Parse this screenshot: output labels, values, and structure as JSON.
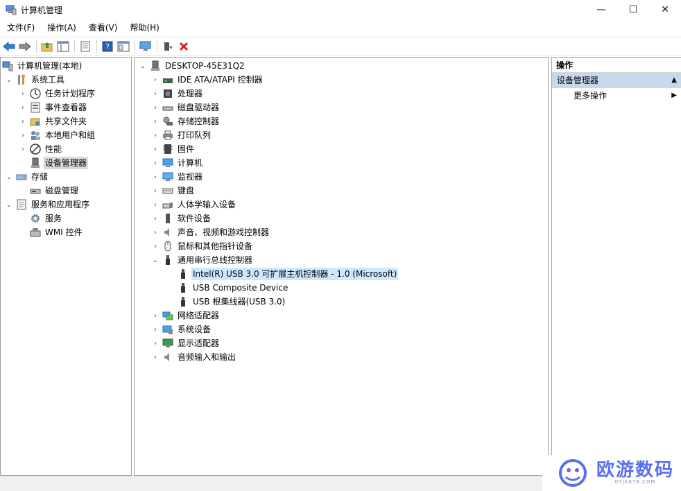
{
  "window": {
    "title": "计算机管理",
    "controls": {
      "minimize": "—",
      "maximize": "☐",
      "close": "✕"
    }
  },
  "menu": [
    "文件(F)",
    "操作(A)",
    "查看(V)",
    "帮助(H)"
  ],
  "left_tree": {
    "root": "计算机管理(本地)",
    "system_tools": "系统工具",
    "task_scheduler": "任务计划程序",
    "event_viewer": "事件查看器",
    "shared_folders": "共享文件夹",
    "local_users": "本地用户和组",
    "performance": "性能",
    "device_manager": "设备管理器",
    "storage": "存储",
    "disk_management": "磁盘管理",
    "services_apps": "服务和应用程序",
    "services": "服务",
    "wmi": "WMI 控件"
  },
  "device_tree": {
    "computer": "DESKTOP-45E31Q2",
    "categories": [
      "IDE ATA/ATAPI 控制器",
      "处理器",
      "磁盘驱动器",
      "存储控制器",
      "打印队列",
      "固件",
      "计算机",
      "监视器",
      "键盘",
      "人体学输入设备",
      "软件设备",
      "声音、视频和游戏控制器",
      "鼠标和其他指针设备",
      "通用串行总线控制器"
    ],
    "usb_children": [
      "Intel(R) USB 3.0 可扩展主机控制器 - 1.0 (Microsoft)",
      "USB Composite Device",
      "USB 根集线器(USB 3.0)"
    ],
    "after": [
      "网络适配器",
      "系统设备",
      "显示适配器",
      "音频输入和输出"
    ]
  },
  "actions": {
    "header": "操作",
    "group": "设备管理器",
    "more": "更多操作"
  },
  "watermark": {
    "text": "欧游数码",
    "sub": "OYJK678.COM"
  }
}
